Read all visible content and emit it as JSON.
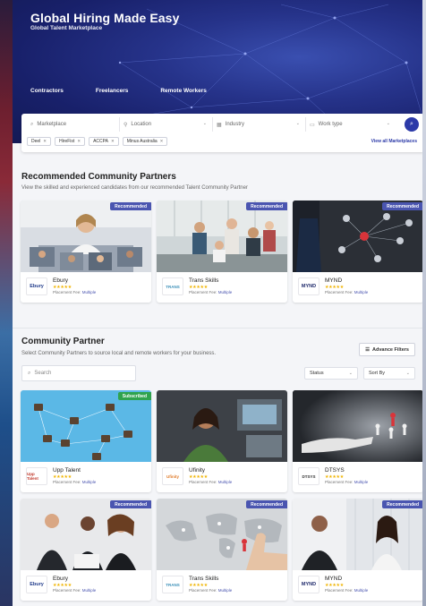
{
  "hero": {
    "title": "Global Hiring Made Easy",
    "subtitle": "Global Talent Marketplace",
    "tabs": [
      "Contractors",
      "Freelancers",
      "Remote Workers"
    ]
  },
  "search": {
    "fields": [
      {
        "label": "Marketplace",
        "icon": "search-icon"
      },
      {
        "label": "Location",
        "icon": "location-pin-icon"
      },
      {
        "label": "Industry",
        "icon": "industry-icon"
      },
      {
        "label": "Work type",
        "icon": "briefcase-icon"
      }
    ],
    "chips": [
      "Deel",
      "HireFist",
      "ACCPA",
      "Minus Australia"
    ],
    "view_all": "View all Marketplaces"
  },
  "recommended": {
    "title": "Recommended Community Partners",
    "description": "View the skilled and experienced candidates from our recommended Talent Community Partner",
    "cards": [
      {
        "badge": "Recommended",
        "logo": "Ebury",
        "name": "Ebury",
        "rating": "★★★★★",
        "fee_label": "Placement Fee:",
        "fee_value": "Multiple"
      },
      {
        "badge": "Recommended",
        "logo": "TRANS",
        "name": "Trans Skills",
        "rating": "★★★★★",
        "fee_label": "Placement Fee:",
        "fee_value": "Multiple"
      },
      {
        "badge": "Recommended",
        "logo": "MYND",
        "name": "MYND",
        "rating": "★★★★★",
        "fee_label": "Placement Fee:",
        "fee_value": "Multiple"
      }
    ]
  },
  "community": {
    "title": "Community Partner",
    "description": "Select Community Partners to source local and remote workers for your business.",
    "advanced_filters": "Advance Filters",
    "search_placeholder": "Search",
    "status_label": "Status",
    "sort_label": "Sort By",
    "cards": [
      {
        "badge": "Subscribed",
        "logo": "Upp Talent",
        "name": "Upp Talent",
        "rating": "★★★★★",
        "fee_label": "Placement Fee:",
        "fee_value": "Multiple"
      },
      {
        "badge": "",
        "logo": "Ufinity",
        "name": "Ufinity",
        "rating": "★★★★★",
        "fee_label": "Placement Fee:",
        "fee_value": "Multiple"
      },
      {
        "badge": "",
        "logo": "DTSYS",
        "name": "DTSYS",
        "rating": "★★★★★",
        "fee_label": "Placement Fee:",
        "fee_value": "Multiple"
      },
      {
        "badge": "Recommended",
        "logo": "Ebury",
        "name": "Ebury",
        "rating": "★★★★★",
        "fee_label": "Placement Fee:",
        "fee_value": "Multiple"
      },
      {
        "badge": "Recommended",
        "logo": "TRANS",
        "name": "Trans Skills",
        "rating": "★★★★★",
        "fee_label": "Placement Fee:",
        "fee_value": "Multiple"
      },
      {
        "badge": "Recommended",
        "logo": "MYND",
        "name": "MYND",
        "rating": "★★★★★",
        "fee_label": "Placement Fee:",
        "fee_value": "Multiple"
      }
    ]
  },
  "colors": {
    "primary": "#2c3aa8",
    "badge_recommended": "#4a55b0",
    "badge_subscribed": "#2fa34d",
    "star": "#f0b400"
  }
}
